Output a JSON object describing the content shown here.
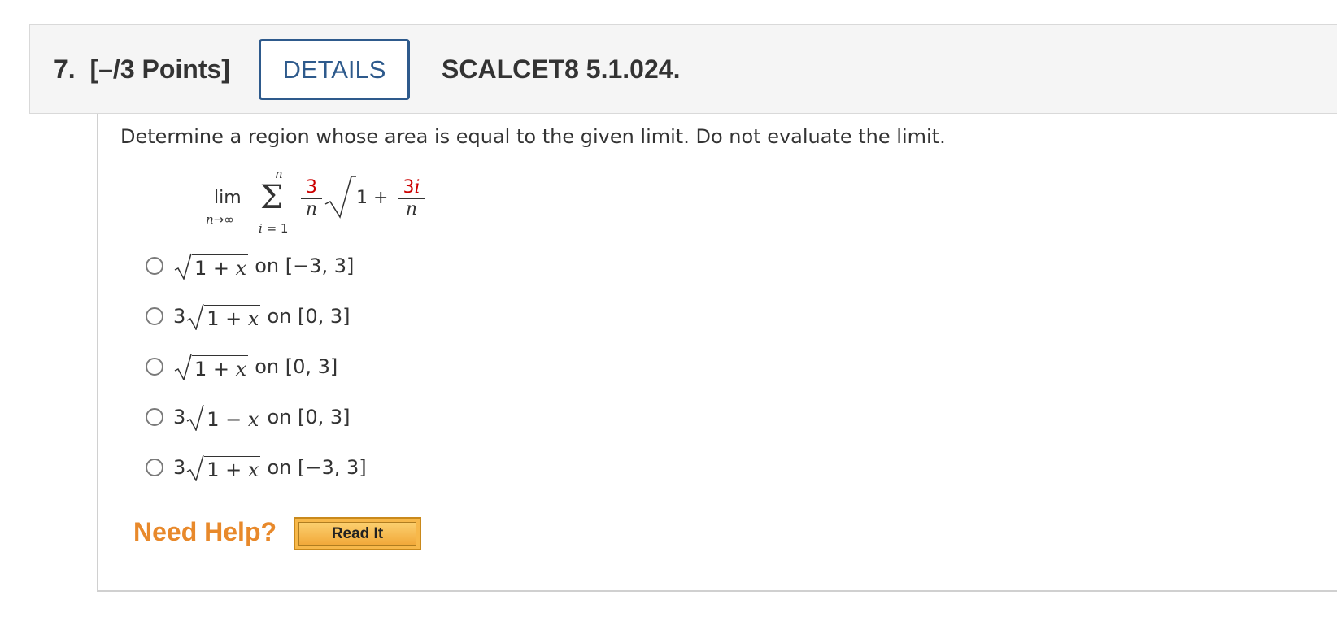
{
  "header": {
    "question_number": "7.",
    "points": "[–/3 Points]",
    "details_label": "DETAILS",
    "problem_code": "SCALCET8 5.1.024."
  },
  "question": {
    "prompt": "Determine a region whose area is equal to the given limit. Do not evaluate the limit.",
    "expression": {
      "lim_word": "lim",
      "lim_var": "n",
      "lim_arrow": "→",
      "lim_to": "∞",
      "sigma": "Σ",
      "sum_upper": "n",
      "sum_lower_var": "i",
      "sum_lower_rest": " = 1",
      "frac1_num": "3",
      "frac1_den": "n",
      "inner_one_plus": "1 +",
      "frac2_num_coef": "3",
      "frac2_num_var": "i",
      "frac2_den": "n"
    }
  },
  "options": [
    {
      "coef": "",
      "radicand_pre": "1 + ",
      "var": "x",
      "suffix": "on [−3, 3]",
      "selected": false
    },
    {
      "coef": "3",
      "radicand_pre": "1 + ",
      "var": "x",
      "suffix": "on [0, 3]",
      "selected": false
    },
    {
      "coef": "",
      "radicand_pre": "1 + ",
      "var": "x",
      "suffix": "on [0, 3]",
      "selected": false
    },
    {
      "coef": "3",
      "radicand_pre": "1 − ",
      "var": "x",
      "suffix": "on [0, 3]",
      "selected": false
    },
    {
      "coef": "3",
      "radicand_pre": "1 + ",
      "var": "x",
      "suffix": "on [−3, 3]",
      "selected": false
    }
  ],
  "help": {
    "need_help_label": "Need Help?",
    "read_it_label": "Read It"
  },
  "colors": {
    "details_border": "#2e5a8c",
    "highlight_red": "#cc0000",
    "need_help_orange": "#e8892b"
  }
}
